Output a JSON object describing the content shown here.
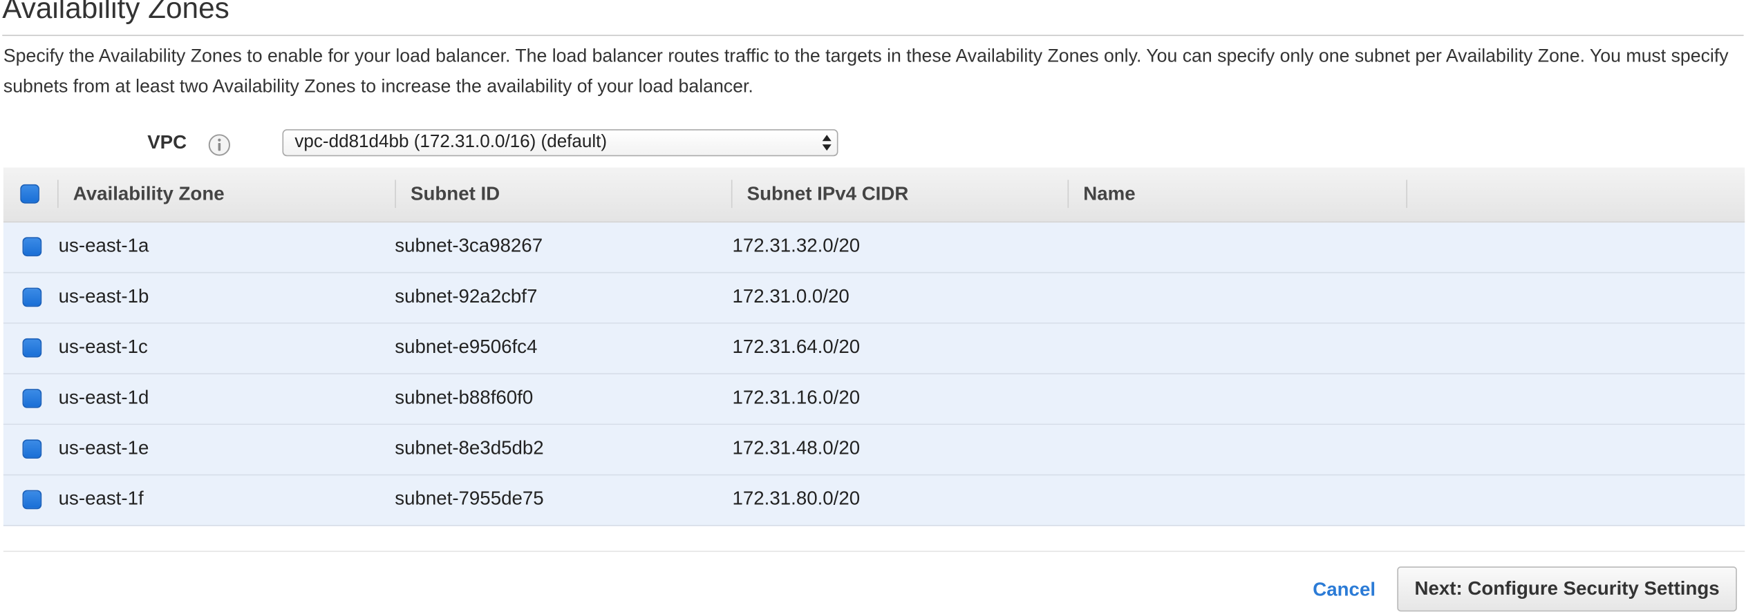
{
  "section": {
    "title": "Availability Zones",
    "description": "Specify the Availability Zones to enable for your load balancer. The load balancer routes traffic to the targets in these Availability Zones only. You can specify only one subnet per Availability Zone. You must specify subnets from at least two Availability Zones to increase the availability of your load balancer."
  },
  "vpc": {
    "label": "VPC",
    "info_icon": "info-icon",
    "selected": "vpc-dd81d4bb (172.31.0.0/16) (default)"
  },
  "table": {
    "columns": [
      "Availability Zone",
      "Subnet ID",
      "Subnet IPv4 CIDR",
      "Name"
    ],
    "select_all_checked": true,
    "rows": [
      {
        "zone": "us-east-1a",
        "subnet_id": "subnet-3ca98267",
        "cidr": "172.31.32.0/20",
        "name": "",
        "checked": true
      },
      {
        "zone": "us-east-1b",
        "subnet_id": "subnet-92a2cbf7",
        "cidr": "172.31.0.0/20",
        "name": "",
        "checked": true
      },
      {
        "zone": "us-east-1c",
        "subnet_id": "subnet-e9506fc4",
        "cidr": "172.31.64.0/20",
        "name": "",
        "checked": true
      },
      {
        "zone": "us-east-1d",
        "subnet_id": "subnet-b88f60f0",
        "cidr": "172.31.16.0/20",
        "name": "",
        "checked": true
      },
      {
        "zone": "us-east-1e",
        "subnet_id": "subnet-8e3d5db2",
        "cidr": "172.31.48.0/20",
        "name": "",
        "checked": true
      },
      {
        "zone": "us-east-1f",
        "subnet_id": "subnet-7955de75",
        "cidr": "172.31.80.0/20",
        "name": "",
        "checked": true
      }
    ]
  },
  "footer": {
    "cancel_label": "Cancel",
    "next_label": "Next: Configure Security Settings"
  },
  "colors": {
    "accent_blue": "#2b7bd6",
    "checkbox_blue": "#1a6fd6",
    "row_selected_bg": "#eaf1fb",
    "header_bg": "#e8e8e8"
  }
}
